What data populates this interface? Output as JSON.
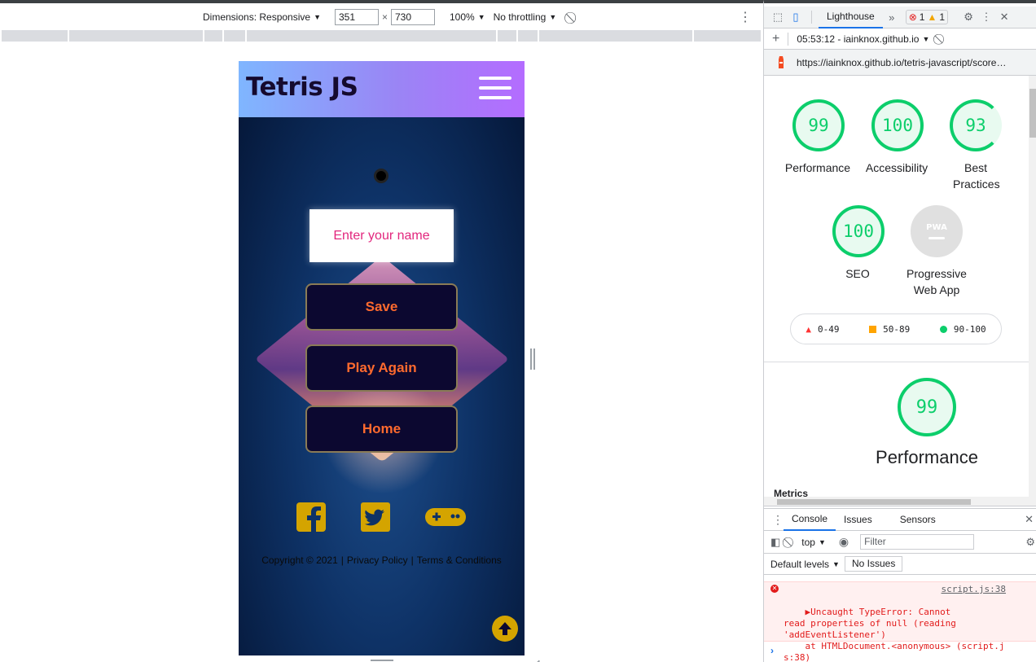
{
  "devbar": {
    "dimensions_label": "Dimensions: Responsive",
    "width_value": "351",
    "times": "×",
    "height_value": "730",
    "zoom": "100%",
    "throttle": "No throttling"
  },
  "device": {
    "logo": "Tetris JS",
    "name_placeholder": "Enter your name",
    "buttons": {
      "save": "Save",
      "play_again": "Play Again",
      "home": "Home"
    },
    "footer": {
      "copyright": "Copyright © 2021",
      "sep": "|",
      "privacy": "Privacy Policy",
      "terms": "Terms & Conditions"
    },
    "colors": {
      "accent": "#ff6a2e",
      "icon": "#d4a400",
      "button_bg": "#0c0830"
    }
  },
  "devtools": {
    "tab_lighthouse": "Lighthouse",
    "error_count": "1",
    "warning_count": "1",
    "report_time": "05:53:12 - iainknox.github.io",
    "url": "https://iainknox.github.io/tetris-javascript/score…",
    "scores": {
      "performance": {
        "value": "99",
        "label": "Performance"
      },
      "accessibility": {
        "value": "100",
        "label": "Accessibility"
      },
      "best_practices": {
        "value": "93",
        "label": "Best Practices"
      },
      "seo": {
        "value": "100",
        "label": "SEO"
      },
      "pwa": {
        "value": "PWA",
        "label": "Progressive Web App"
      }
    },
    "legend": {
      "low": "0-49",
      "mid": "50-89",
      "high": "90-100"
    },
    "big_score": {
      "value": "99",
      "label": "Performance"
    },
    "metrics_label": "Metrics",
    "drawer": {
      "tab_console": "Console",
      "tab_issues": "Issues",
      "tab_sensors": "Sensors",
      "context": "top",
      "filter_placeholder": "Filter",
      "levels": "Default levels",
      "no_issues": "No Issues"
    },
    "error": {
      "text": "▶Uncaught TypeError: Cannot\nread properties of null (reading\n'addEventListener')\n    at HTMLDocument.<anonymous> (script.j\ns:38)",
      "link": "script.js:38"
    }
  }
}
